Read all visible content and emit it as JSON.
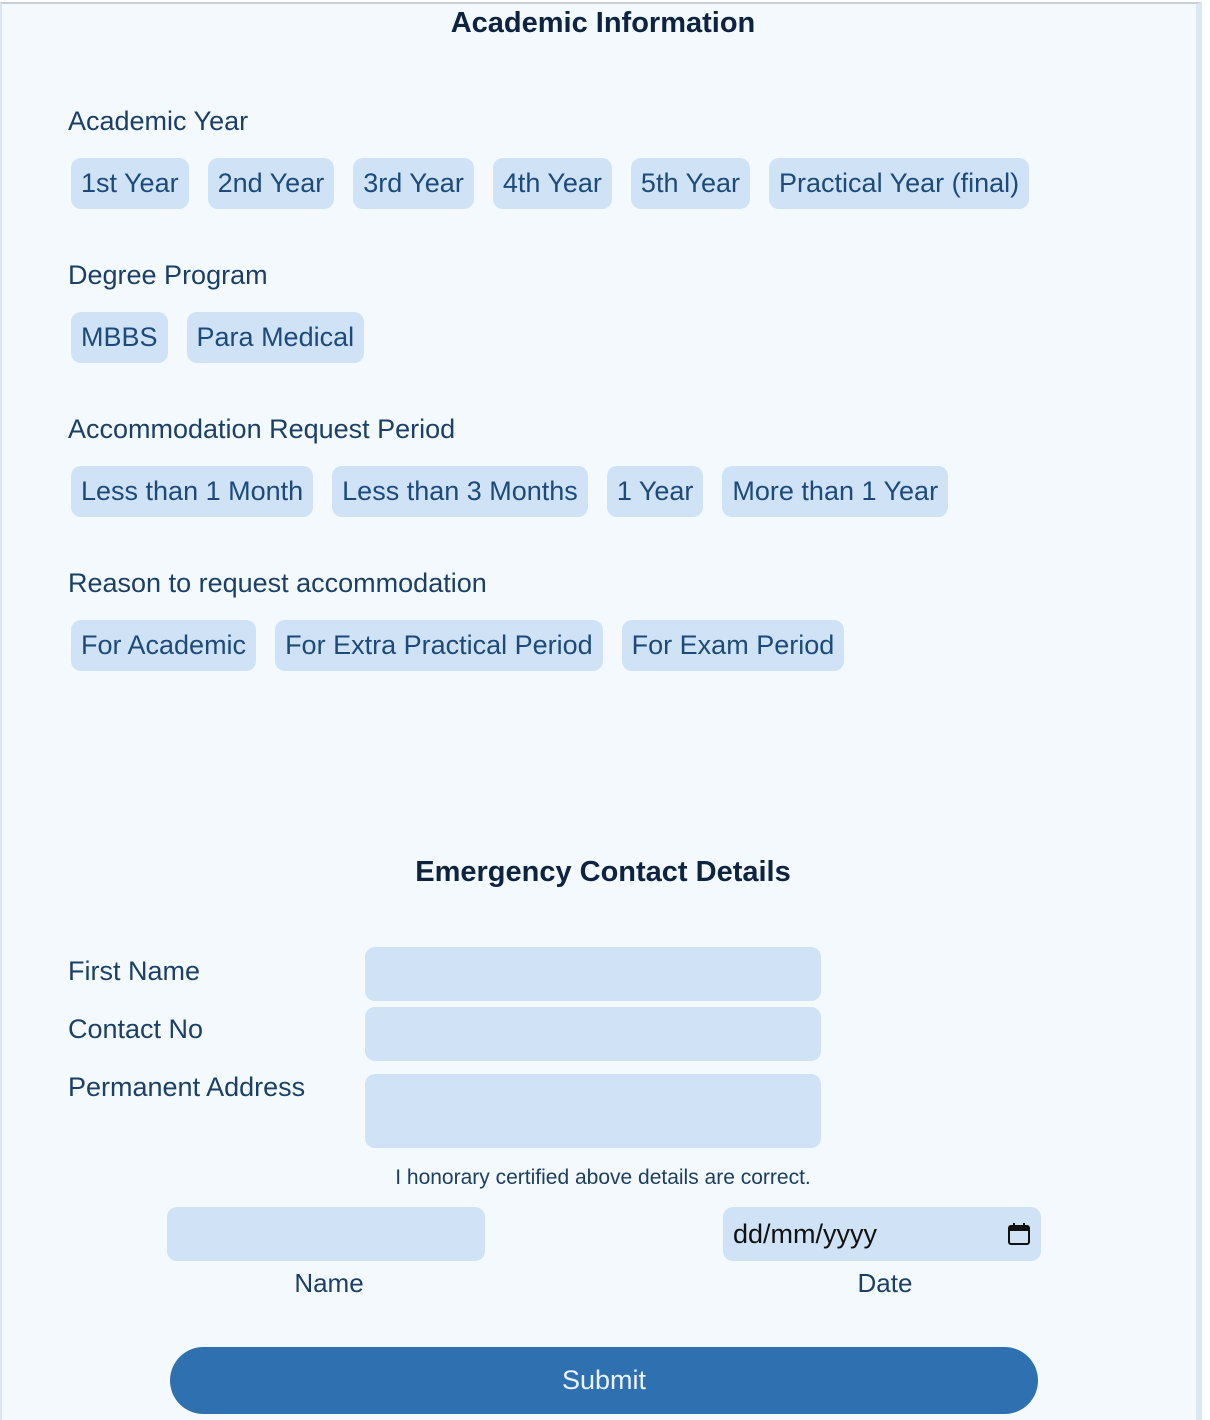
{
  "academic_info": {
    "title": "Academic Information",
    "academic_year": {
      "label": "Academic Year",
      "options": [
        "1st Year",
        "2nd Year",
        "3rd Year",
        "4th Year",
        "5th Year",
        "Practical Year (final)"
      ]
    },
    "degree_program": {
      "label": "Degree Program",
      "options": [
        "MBBS",
        "Para Medical"
      ]
    },
    "accommodation_period": {
      "label": "Accommodation Request Period",
      "options": [
        "Less than 1 Month",
        "Less than 3 Months",
        "1 Year",
        "More than 1 Year"
      ]
    },
    "reason": {
      "label": "Reason to request accommodation",
      "options": [
        "For Academic",
        "For Extra Practical Period",
        "For Exam Period"
      ]
    }
  },
  "emergency": {
    "title": "Emergency Contact Details",
    "first_name_label": "First Name",
    "contact_no_label": "Contact No",
    "address_label": "Permanent Address",
    "first_name_value": "",
    "contact_no_value": "",
    "address_value": ""
  },
  "certification": {
    "text": "I honorary certified above details are correct.",
    "name_value": "",
    "date_placeholder": "dd/mm/yyyy",
    "name_caption": "Name",
    "date_caption": "Date"
  },
  "submit_label": "Submit",
  "colors": {
    "panel_bg": "#f3f9fd",
    "chip_bg": "#cfe2f6",
    "label_text": "#1b3f66",
    "heading_text": "#0d2340",
    "submit_bg": "#2e70b0"
  },
  "icons": {
    "date_picker": "calendar-icon"
  }
}
